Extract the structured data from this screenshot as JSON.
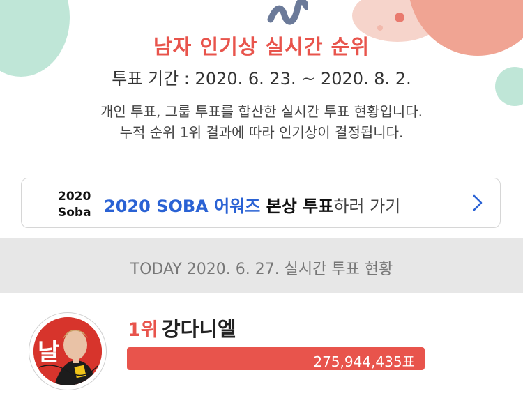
{
  "header": {
    "title": "남자 인기상 실시간 순위",
    "period": "투표 기간 : 2020. 6. 23. ~ 2020. 8. 2.",
    "description_line1": "개인 투표, 그룹 투표를 합산한 실시간 투표 현황입니다.",
    "description_line2": "누적 순위 1위 결과에 따라 인기상이 결정됩니다."
  },
  "banner": {
    "logo_top": "2020",
    "logo_bottom": "Soba",
    "text_blue": "2020 SOBA 어워즈",
    "text_bold": " 본상 투표",
    "text_normal": "하러 가기",
    "chevron_icon": "chevron-right-icon"
  },
  "today": {
    "label": "TODAY 2020. 6. 27. 실시간 투표 현황"
  },
  "ranking": [
    {
      "rank": "1위",
      "name": "강다니엘",
      "votes": "275,944,435표",
      "avatar_text": "날"
    }
  ],
  "colors": {
    "accent": "#e8544c",
    "link_blue": "#2a62d4",
    "today_bg": "#e7e7e7"
  }
}
